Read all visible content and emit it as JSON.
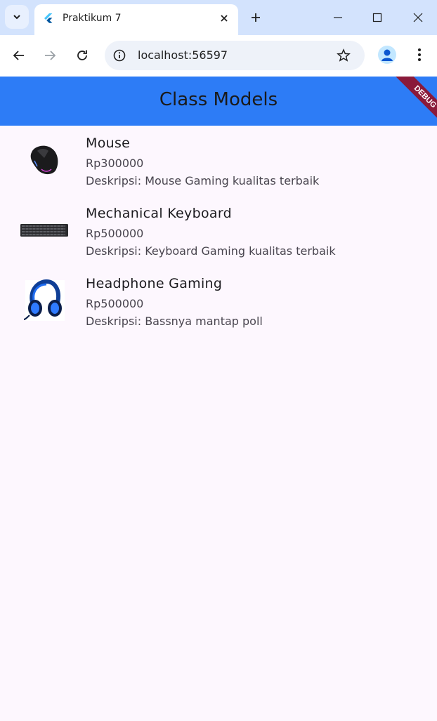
{
  "browser": {
    "tab_title": "Praktikum 7",
    "url": "localhost:56597"
  },
  "app": {
    "title": "Class Models",
    "debug_label": "DEBUG",
    "accent_color": "#2d7cf6"
  },
  "products": [
    {
      "name": "Mouse",
      "price": "Rp300000",
      "description": "Deskripsi: Mouse Gaming kualitas terbaik",
      "image": "mouse"
    },
    {
      "name": "Mechanical Keyboard",
      "price": "Rp500000",
      "description": "Deskripsi: Keyboard Gaming kualitas terbaik",
      "image": "keyboard"
    },
    {
      "name": "Headphone Gaming",
      "price": "Rp500000",
      "description": "Deskripsi: Bassnya mantap poll",
      "image": "headphone"
    }
  ]
}
